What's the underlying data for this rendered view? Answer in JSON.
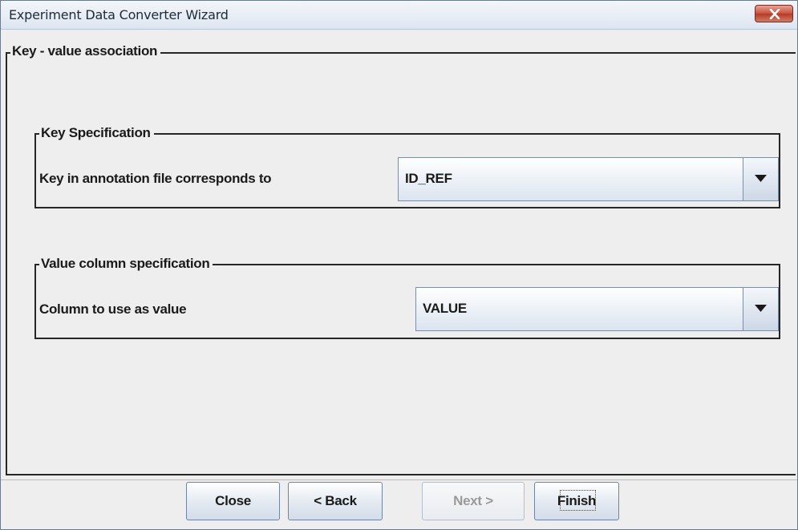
{
  "window": {
    "title": "Experiment Data Converter Wizard"
  },
  "main_group": {
    "legend": "Key - value association"
  },
  "key_spec": {
    "legend": "Key Specification",
    "label": "Key in annotation file corresponds to",
    "selected": "ID_REF"
  },
  "value_spec": {
    "legend": "Value column specification",
    "label": "Column to use as value",
    "selected": "VALUE"
  },
  "buttons": {
    "close": "Close",
    "back": "< Back",
    "next": "Next >",
    "finish": "Finish"
  },
  "icons": {
    "close": "close-icon",
    "dropdown": "chevron-down-icon"
  }
}
